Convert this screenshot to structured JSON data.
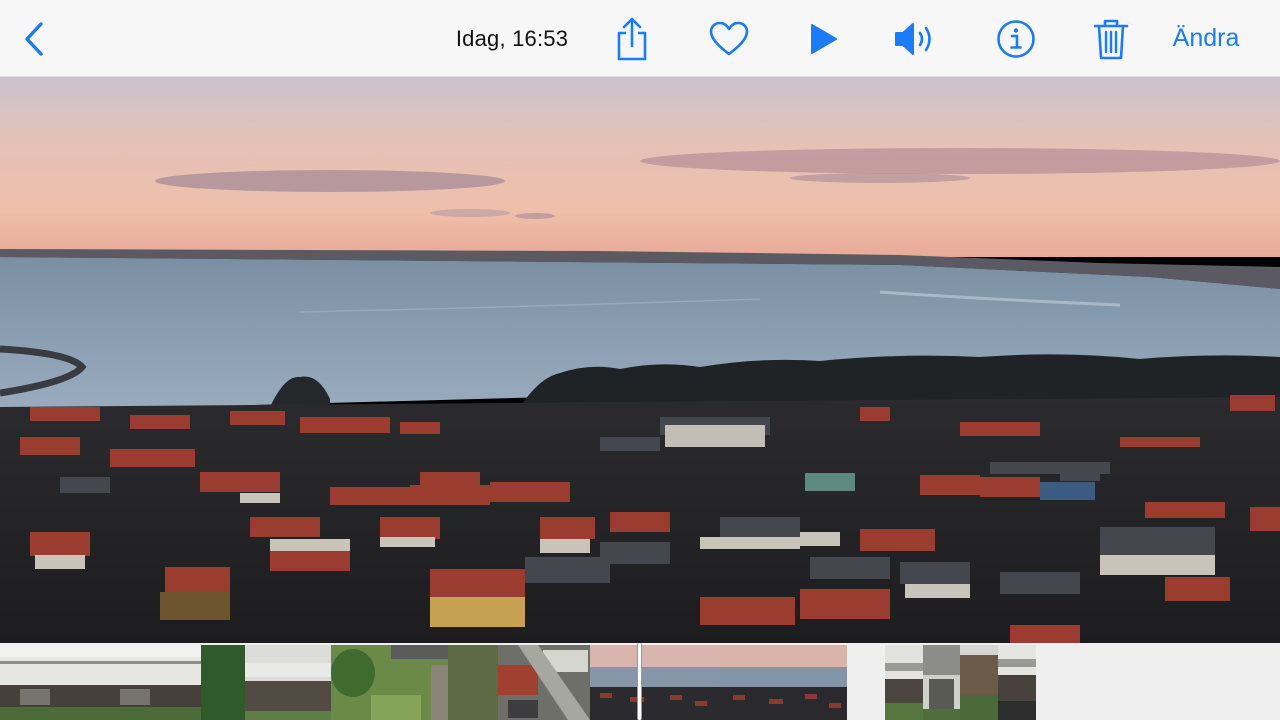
{
  "toolbar": {
    "back_icon": "chevron-left-icon",
    "date_label": "Idag, 16:53",
    "share_icon": "share-icon",
    "favorite_icon": "heart-icon",
    "play_icon": "play-icon",
    "sound_icon": "speaker-icon",
    "info_icon": "info-icon",
    "delete_icon": "trash-icon",
    "edit_label": "Ändra",
    "accent_color": "#1b7cf5"
  },
  "photo": {
    "subject": "aerial-coastal-town-at-dusk"
  },
  "filmstrip": {
    "frames": [
      {
        "kind": "balcony-building"
      },
      {
        "kind": "hedge-building"
      },
      {
        "kind": "garden"
      },
      {
        "kind": "aerial-houses"
      },
      {
        "kind": "sunset-coast"
      },
      {
        "kind": "sunset-coast"
      },
      {
        "kind": "building-small"
      },
      {
        "kind": "building-small"
      },
      {
        "kind": "trees-small"
      },
      {
        "kind": "building-small"
      }
    ]
  }
}
